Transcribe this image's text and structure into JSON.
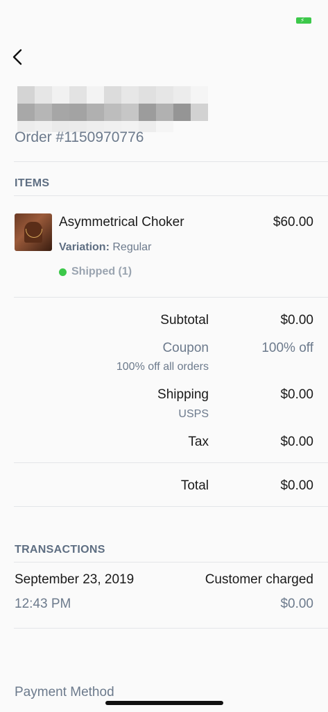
{
  "order": {
    "number": "Order #1150970776"
  },
  "items_section": {
    "header": "ITEMS",
    "items": [
      {
        "name": "Asymmetrical Choker",
        "price": "$60.00",
        "variation_label": "Variation:",
        "variation_value": "Regular",
        "status": "Shipped (1)"
      }
    ]
  },
  "summary": {
    "subtotal_label": "Subtotal",
    "subtotal_value": "$0.00",
    "coupon_label": "Coupon",
    "coupon_value": "100% off",
    "coupon_detail": "100% off all orders",
    "shipping_label": "Shipping",
    "shipping_value": "$0.00",
    "shipping_carrier": "USPS",
    "tax_label": "Tax",
    "tax_value": "$0.00",
    "total_label": "Total",
    "total_value": "$0.00"
  },
  "transactions": {
    "header": "TRANSACTIONS",
    "items": [
      {
        "date": "September 23, 2019",
        "time": "12:43 PM",
        "status": "Customer charged",
        "amount": "$0.00"
      }
    ]
  },
  "payment": {
    "label": "Payment Method"
  },
  "colors": {
    "accent_green": "#3cc84a",
    "muted_text": "#6c7a8c",
    "header_text": "#5e6e82"
  },
  "icons": {
    "back": "chevron-left-icon",
    "battery": "battery-icon",
    "status_dot": "status-dot-icon"
  }
}
